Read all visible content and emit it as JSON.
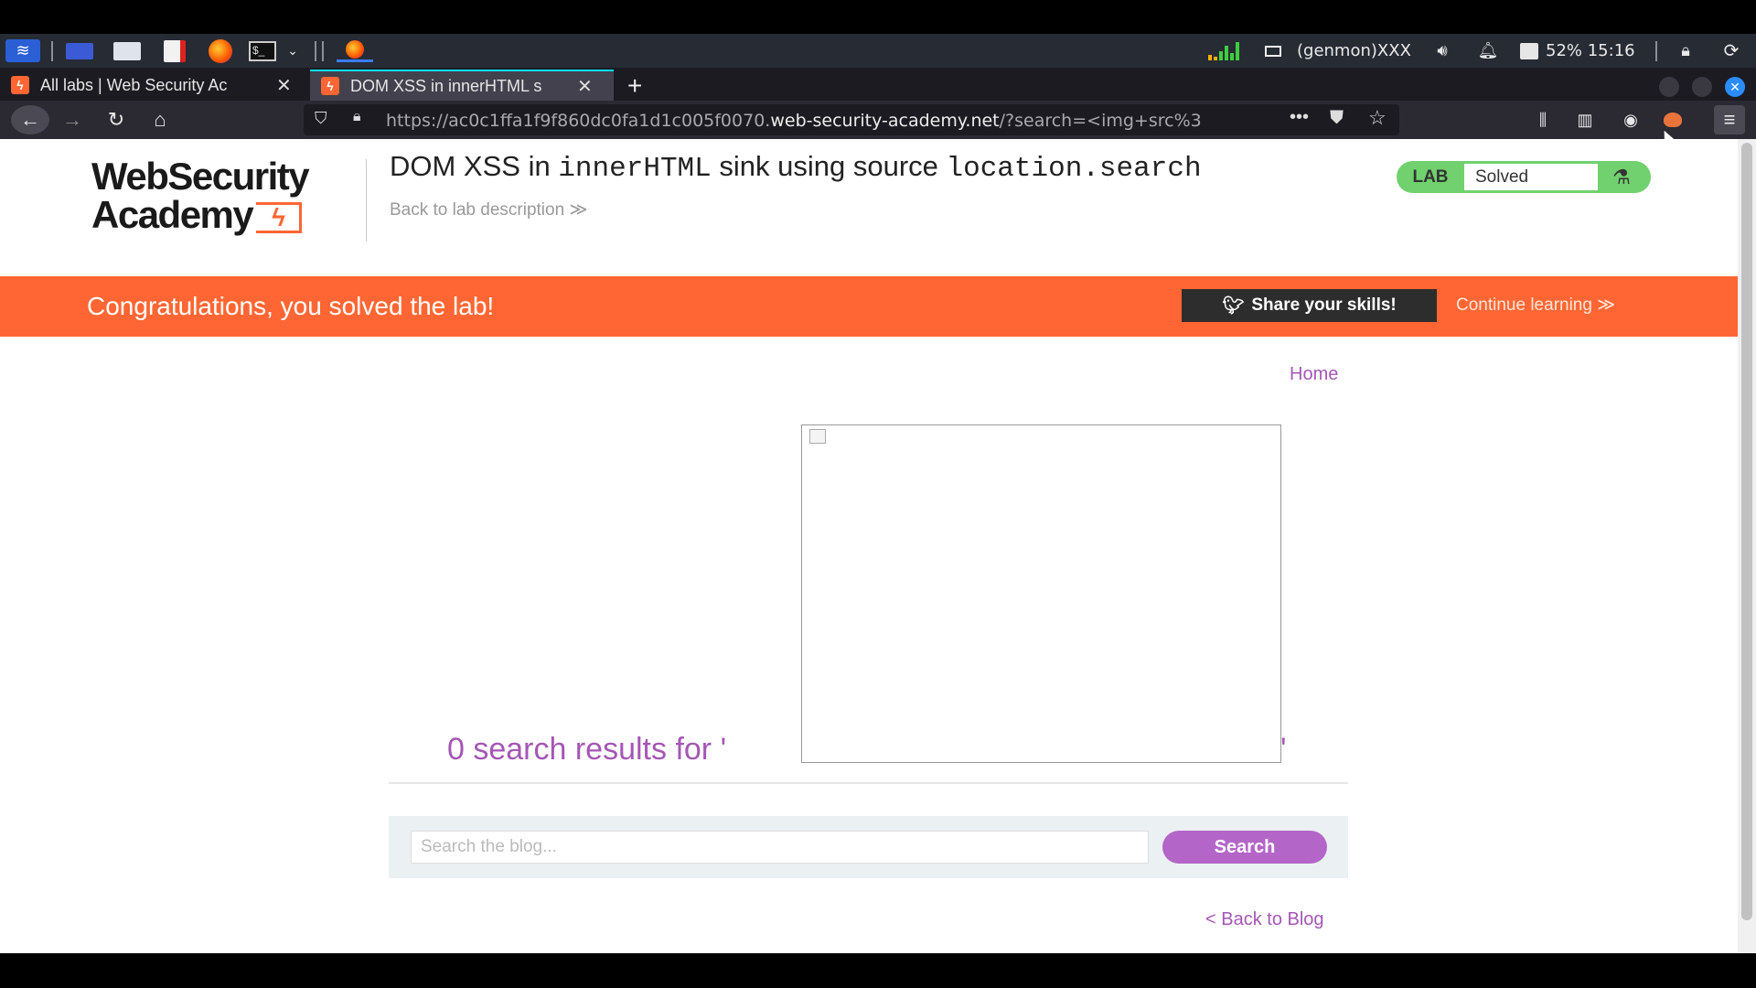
{
  "taskbar": {
    "status_text": "(genmon)XXX",
    "battery_time": "52% 15:16"
  },
  "tabs": [
    {
      "title": "All labs | Web Security Ac",
      "active": false
    },
    {
      "title": "DOM XSS in innerHTML s",
      "active": true
    }
  ],
  "navbar": {
    "url_prefix": "https://ac0c1ffa1f9f860dc0fa1d1c005f0070.",
    "url_domain": "web-security-academy.net",
    "url_suffix": "/?search=<img+src%3"
  },
  "header": {
    "logo_line1": "WebSecurity",
    "logo_line2": "Academy",
    "title_prefix": "DOM XSS in ",
    "title_code1": "innerHTML",
    "title_mid": " sink using source ",
    "title_code2": "location.search",
    "back_link": "Back to lab description  ≫"
  },
  "lab_badge": {
    "label": "LAB",
    "status": "Solved"
  },
  "banner": {
    "message": "Congratulations, you solved the lab!",
    "share_label": "Share your skills!",
    "continue_label": "Continue learning ≫"
  },
  "nav": {
    "home": "Home"
  },
  "results": {
    "text": "0 search results for '",
    "close_quote": "'"
  },
  "search": {
    "placeholder": "Search the blog...",
    "button": "Search"
  },
  "footer_link": "< Back to Blog",
  "colors": {
    "accent_orange": "#ff6633",
    "link_purple": "#a457b4",
    "search_button": "#b366c8",
    "solved_green": "#70d16e"
  }
}
